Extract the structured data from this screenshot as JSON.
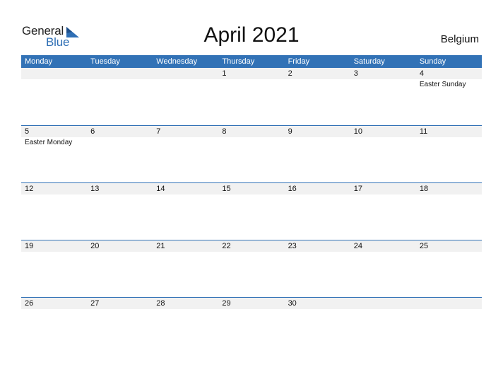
{
  "logo": {
    "word1": "General",
    "word2": "Blue"
  },
  "title": "April 2021",
  "country": "Belgium",
  "colors": {
    "header_bg": "#3272b6",
    "row_bg": "#f1f1f1",
    "accent": "#2f6fb5"
  },
  "days": [
    "Monday",
    "Tuesday",
    "Wednesday",
    "Thursday",
    "Friday",
    "Saturday",
    "Sunday"
  ],
  "weeks": [
    {
      "dates": [
        "",
        "",
        "",
        "1",
        "2",
        "3",
        "4"
      ],
      "events": [
        "",
        "",
        "",
        "",
        "",
        "",
        "Easter Sunday"
      ]
    },
    {
      "dates": [
        "5",
        "6",
        "7",
        "8",
        "9",
        "10",
        "11"
      ],
      "events": [
        "Easter Monday",
        "",
        "",
        "",
        "",
        "",
        ""
      ]
    },
    {
      "dates": [
        "12",
        "13",
        "14",
        "15",
        "16",
        "17",
        "18"
      ],
      "events": [
        "",
        "",
        "",
        "",
        "",
        "",
        ""
      ]
    },
    {
      "dates": [
        "19",
        "20",
        "21",
        "22",
        "23",
        "24",
        "25"
      ],
      "events": [
        "",
        "",
        "",
        "",
        "",
        "",
        ""
      ]
    },
    {
      "dates": [
        "26",
        "27",
        "28",
        "29",
        "30",
        "",
        ""
      ],
      "events": [
        "",
        "",
        "",
        "",
        "",
        "",
        ""
      ]
    }
  ]
}
